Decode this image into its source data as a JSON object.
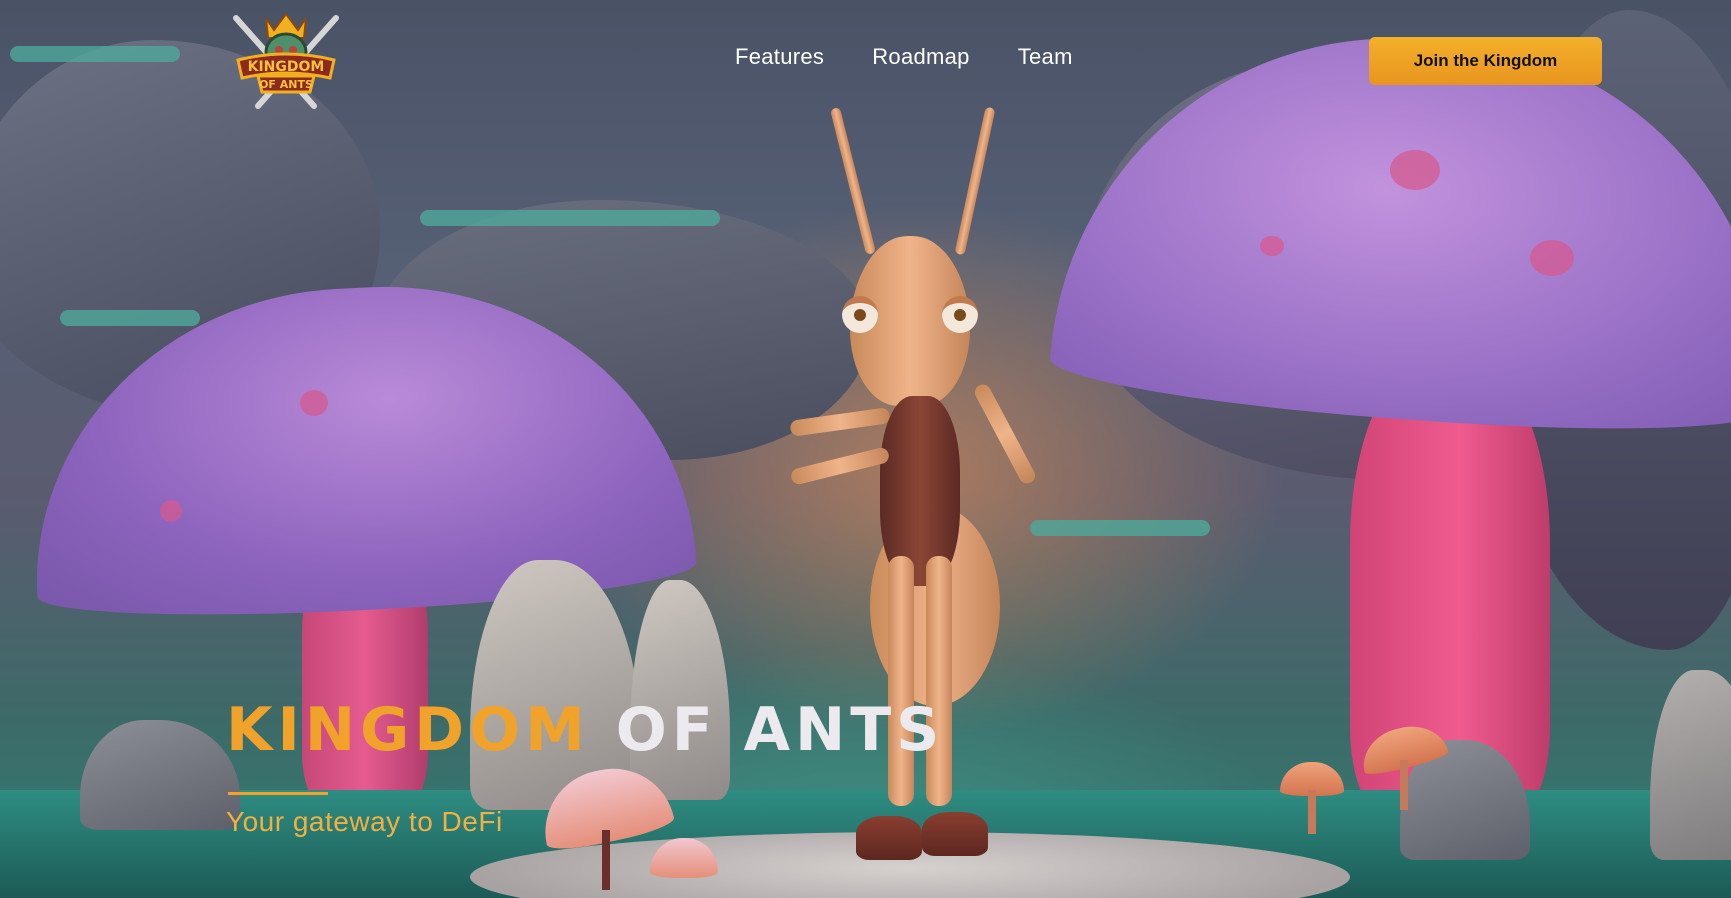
{
  "header": {
    "logo_text": "KINGDOM OF ANTS",
    "nav": [
      {
        "label": "Features"
      },
      {
        "label": "Roadmap"
      },
      {
        "label": "Team"
      }
    ],
    "cta_label": "Join the Kingdom"
  },
  "hero": {
    "title_part1": "KINGDOM",
    "title_part2": "OF ANTS",
    "tagline": "Your gateway to DeFi"
  },
  "colors": {
    "accent": "#f0a22a",
    "cta": "#f4b02a",
    "title_light": "#ece9ef"
  }
}
